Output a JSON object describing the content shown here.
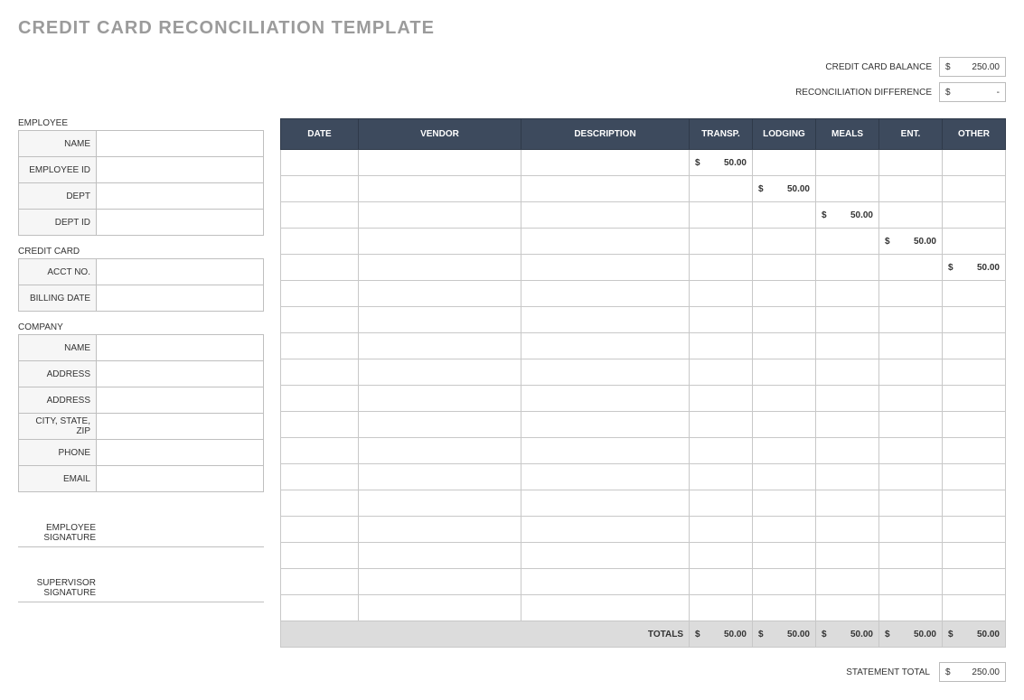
{
  "title": "CREDIT CARD RECONCILIATION TEMPLATE",
  "summary": {
    "balance_label": "CREDIT CARD BALANCE",
    "balance_currency": "$",
    "balance_value": "250.00",
    "diff_label": "RECONCILIATION DIFFERENCE",
    "diff_currency": "$",
    "diff_value": "-"
  },
  "sections": {
    "employee": {
      "title": "EMPLOYEE",
      "rows": [
        {
          "label": "NAME",
          "value": ""
        },
        {
          "label": "EMPLOYEE ID",
          "value": ""
        },
        {
          "label": "DEPT",
          "value": ""
        },
        {
          "label": "DEPT ID",
          "value": ""
        }
      ]
    },
    "credit_card": {
      "title": "CREDIT CARD",
      "rows": [
        {
          "label": "ACCT NO.",
          "value": ""
        },
        {
          "label": "BILLING DATE",
          "value": ""
        }
      ]
    },
    "company": {
      "title": "COMPANY",
      "rows": [
        {
          "label": "NAME",
          "value": ""
        },
        {
          "label": "ADDRESS",
          "value": ""
        },
        {
          "label": "ADDRESS",
          "value": ""
        },
        {
          "label": "CITY, STATE, ZIP",
          "value": ""
        },
        {
          "label": "PHONE",
          "value": ""
        },
        {
          "label": "EMAIL",
          "value": ""
        }
      ]
    }
  },
  "signatures": {
    "employee": "EMPLOYEE SIGNATURE",
    "supervisor": "SUPERVISOR SIGNATURE"
  },
  "table": {
    "headers": [
      "DATE",
      "VENDOR",
      "DESCRIPTION",
      "TRANSP.",
      "LODGING",
      "MEALS",
      "ENT.",
      "OTHER"
    ],
    "currency": "$",
    "rows": [
      {
        "date": "",
        "vendor": "",
        "desc": "",
        "transp": "50.00",
        "lodging": "",
        "meals": "",
        "ent": "",
        "other": ""
      },
      {
        "date": "",
        "vendor": "",
        "desc": "",
        "transp": "",
        "lodging": "50.00",
        "meals": "",
        "ent": "",
        "other": ""
      },
      {
        "date": "",
        "vendor": "",
        "desc": "",
        "transp": "",
        "lodging": "",
        "meals": "50.00",
        "ent": "",
        "other": ""
      },
      {
        "date": "",
        "vendor": "",
        "desc": "",
        "transp": "",
        "lodging": "",
        "meals": "",
        "ent": "50.00",
        "other": ""
      },
      {
        "date": "",
        "vendor": "",
        "desc": "",
        "transp": "",
        "lodging": "",
        "meals": "",
        "ent": "",
        "other": "50.00"
      },
      {
        "date": "",
        "vendor": "",
        "desc": "",
        "transp": "",
        "lodging": "",
        "meals": "",
        "ent": "",
        "other": ""
      },
      {
        "date": "",
        "vendor": "",
        "desc": "",
        "transp": "",
        "lodging": "",
        "meals": "",
        "ent": "",
        "other": ""
      },
      {
        "date": "",
        "vendor": "",
        "desc": "",
        "transp": "",
        "lodging": "",
        "meals": "",
        "ent": "",
        "other": ""
      },
      {
        "date": "",
        "vendor": "",
        "desc": "",
        "transp": "",
        "lodging": "",
        "meals": "",
        "ent": "",
        "other": ""
      },
      {
        "date": "",
        "vendor": "",
        "desc": "",
        "transp": "",
        "lodging": "",
        "meals": "",
        "ent": "",
        "other": ""
      },
      {
        "date": "",
        "vendor": "",
        "desc": "",
        "transp": "",
        "lodging": "",
        "meals": "",
        "ent": "",
        "other": ""
      },
      {
        "date": "",
        "vendor": "",
        "desc": "",
        "transp": "",
        "lodging": "",
        "meals": "",
        "ent": "",
        "other": ""
      },
      {
        "date": "",
        "vendor": "",
        "desc": "",
        "transp": "",
        "lodging": "",
        "meals": "",
        "ent": "",
        "other": ""
      },
      {
        "date": "",
        "vendor": "",
        "desc": "",
        "transp": "",
        "lodging": "",
        "meals": "",
        "ent": "",
        "other": ""
      },
      {
        "date": "",
        "vendor": "",
        "desc": "",
        "transp": "",
        "lodging": "",
        "meals": "",
        "ent": "",
        "other": ""
      },
      {
        "date": "",
        "vendor": "",
        "desc": "",
        "transp": "",
        "lodging": "",
        "meals": "",
        "ent": "",
        "other": ""
      },
      {
        "date": "",
        "vendor": "",
        "desc": "",
        "transp": "",
        "lodging": "",
        "meals": "",
        "ent": "",
        "other": ""
      },
      {
        "date": "",
        "vendor": "",
        "desc": "",
        "transp": "",
        "lodging": "",
        "meals": "",
        "ent": "",
        "other": ""
      }
    ],
    "totals_label": "TOTALS",
    "totals": {
      "transp": "50.00",
      "lodging": "50.00",
      "meals": "50.00",
      "ent": "50.00",
      "other": "50.00"
    }
  },
  "statement_total": {
    "label": "STATEMENT TOTAL",
    "currency": "$",
    "value": "250.00"
  }
}
